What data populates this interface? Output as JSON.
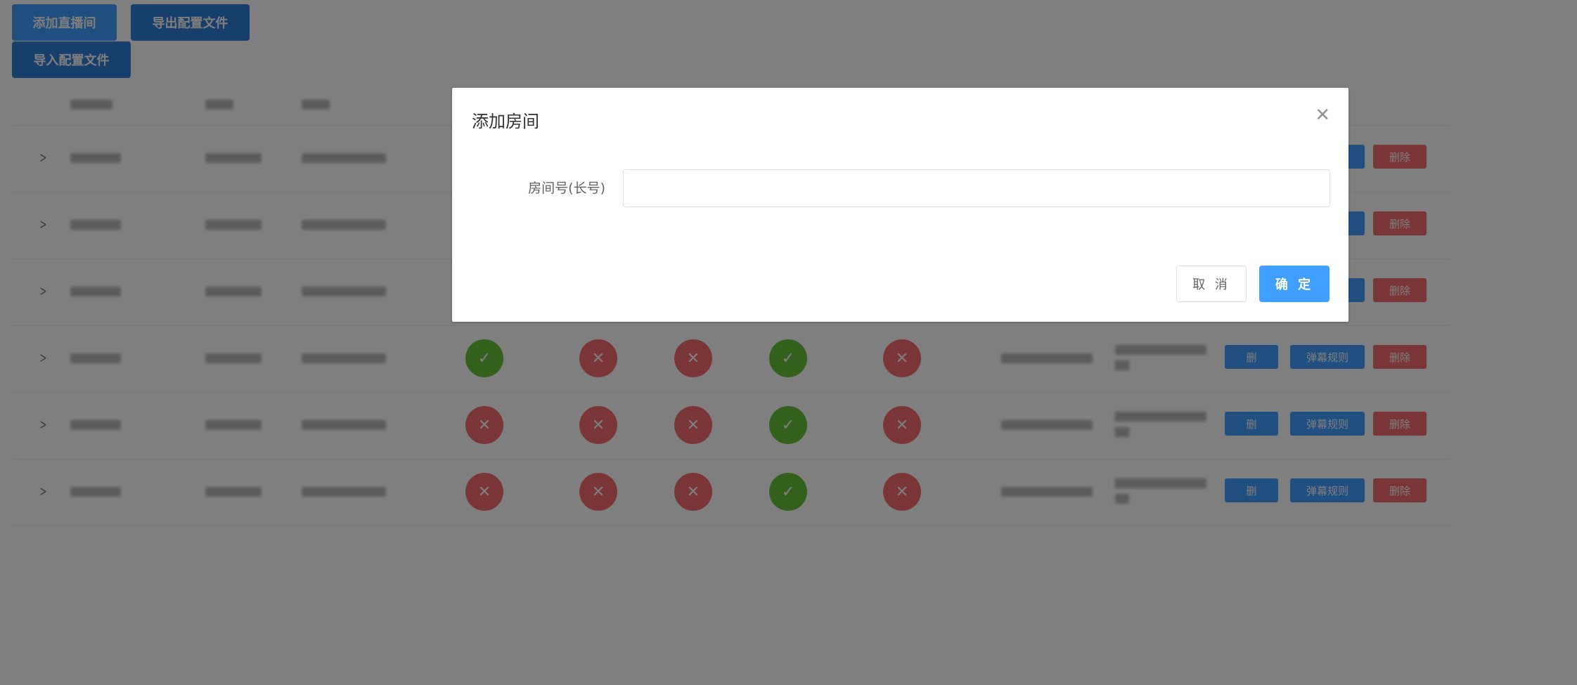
{
  "toolbar": {
    "add_room_label": "添加直播间",
    "export_label": "导出配置文件",
    "import_label": "导入配置文件"
  },
  "table": {
    "row_buttons": {
      "detail_label": "删",
      "danmaku_rules_label": "弹幕规则",
      "delete_label": "删除"
    },
    "rows": [
      {
        "statuses": [
          null,
          null,
          null,
          null,
          null
        ]
      },
      {
        "statuses": [
          null,
          null,
          null,
          null,
          null
        ]
      },
      {
        "statuses": [
          null,
          null,
          null,
          null,
          null
        ]
      },
      {
        "statuses": [
          "ok",
          "no",
          "no",
          "ok",
          "no"
        ]
      },
      {
        "statuses": [
          "no",
          "no",
          "no",
          "ok",
          "no"
        ]
      },
      {
        "statuses": [
          "no",
          "no",
          "no",
          "ok",
          "no"
        ]
      }
    ],
    "status_icons": {
      "ok": "check-icon",
      "no": "close-icon"
    },
    "colors": {
      "ok": "#67c23a",
      "no": "#f56c6c"
    }
  },
  "dialog": {
    "title": "添加房间",
    "close_icon": "close-icon",
    "room_field_label": "房间号(长号)",
    "room_field_value": "",
    "cancel_label": "取 消",
    "confirm_label": "确 定"
  },
  "colors": {
    "primary": "#409eff",
    "danger": "#f56c6c",
    "success": "#67c23a"
  }
}
